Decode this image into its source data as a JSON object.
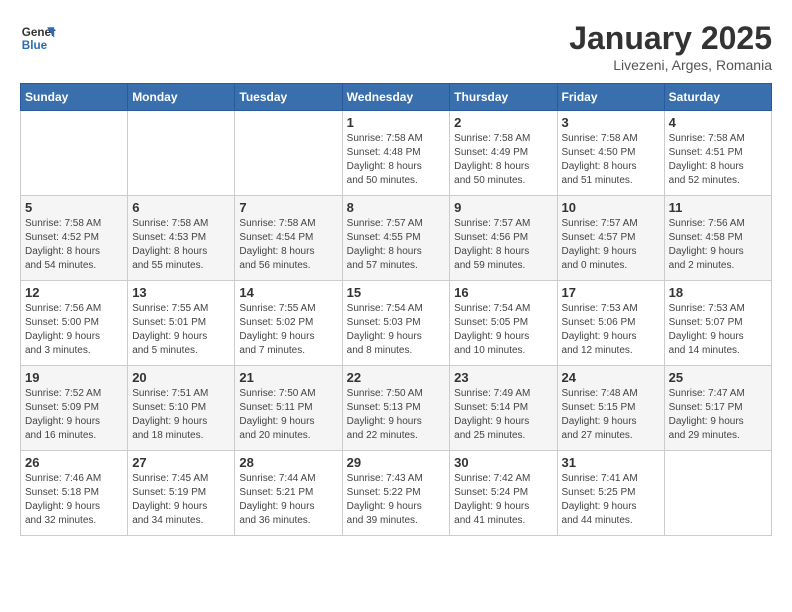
{
  "logo": {
    "general": "General",
    "blue": "Blue"
  },
  "title": "January 2025",
  "subtitle": "Livezeni, Arges, Romania",
  "days_header": [
    "Sunday",
    "Monday",
    "Tuesday",
    "Wednesday",
    "Thursday",
    "Friday",
    "Saturday"
  ],
  "weeks": [
    [
      {
        "day": "",
        "info": ""
      },
      {
        "day": "",
        "info": ""
      },
      {
        "day": "",
        "info": ""
      },
      {
        "day": "1",
        "info": "Sunrise: 7:58 AM\nSunset: 4:48 PM\nDaylight: 8 hours\nand 50 minutes."
      },
      {
        "day": "2",
        "info": "Sunrise: 7:58 AM\nSunset: 4:49 PM\nDaylight: 8 hours\nand 50 minutes."
      },
      {
        "day": "3",
        "info": "Sunrise: 7:58 AM\nSunset: 4:50 PM\nDaylight: 8 hours\nand 51 minutes."
      },
      {
        "day": "4",
        "info": "Sunrise: 7:58 AM\nSunset: 4:51 PM\nDaylight: 8 hours\nand 52 minutes."
      }
    ],
    [
      {
        "day": "5",
        "info": "Sunrise: 7:58 AM\nSunset: 4:52 PM\nDaylight: 8 hours\nand 54 minutes."
      },
      {
        "day": "6",
        "info": "Sunrise: 7:58 AM\nSunset: 4:53 PM\nDaylight: 8 hours\nand 55 minutes."
      },
      {
        "day": "7",
        "info": "Sunrise: 7:58 AM\nSunset: 4:54 PM\nDaylight: 8 hours\nand 56 minutes."
      },
      {
        "day": "8",
        "info": "Sunrise: 7:57 AM\nSunset: 4:55 PM\nDaylight: 8 hours\nand 57 minutes."
      },
      {
        "day": "9",
        "info": "Sunrise: 7:57 AM\nSunset: 4:56 PM\nDaylight: 8 hours\nand 59 minutes."
      },
      {
        "day": "10",
        "info": "Sunrise: 7:57 AM\nSunset: 4:57 PM\nDaylight: 9 hours\nand 0 minutes."
      },
      {
        "day": "11",
        "info": "Sunrise: 7:56 AM\nSunset: 4:58 PM\nDaylight: 9 hours\nand 2 minutes."
      }
    ],
    [
      {
        "day": "12",
        "info": "Sunrise: 7:56 AM\nSunset: 5:00 PM\nDaylight: 9 hours\nand 3 minutes."
      },
      {
        "day": "13",
        "info": "Sunrise: 7:55 AM\nSunset: 5:01 PM\nDaylight: 9 hours\nand 5 minutes."
      },
      {
        "day": "14",
        "info": "Sunrise: 7:55 AM\nSunset: 5:02 PM\nDaylight: 9 hours\nand 7 minutes."
      },
      {
        "day": "15",
        "info": "Sunrise: 7:54 AM\nSunset: 5:03 PM\nDaylight: 9 hours\nand 8 minutes."
      },
      {
        "day": "16",
        "info": "Sunrise: 7:54 AM\nSunset: 5:05 PM\nDaylight: 9 hours\nand 10 minutes."
      },
      {
        "day": "17",
        "info": "Sunrise: 7:53 AM\nSunset: 5:06 PM\nDaylight: 9 hours\nand 12 minutes."
      },
      {
        "day": "18",
        "info": "Sunrise: 7:53 AM\nSunset: 5:07 PM\nDaylight: 9 hours\nand 14 minutes."
      }
    ],
    [
      {
        "day": "19",
        "info": "Sunrise: 7:52 AM\nSunset: 5:09 PM\nDaylight: 9 hours\nand 16 minutes."
      },
      {
        "day": "20",
        "info": "Sunrise: 7:51 AM\nSunset: 5:10 PM\nDaylight: 9 hours\nand 18 minutes."
      },
      {
        "day": "21",
        "info": "Sunrise: 7:50 AM\nSunset: 5:11 PM\nDaylight: 9 hours\nand 20 minutes."
      },
      {
        "day": "22",
        "info": "Sunrise: 7:50 AM\nSunset: 5:13 PM\nDaylight: 9 hours\nand 22 minutes."
      },
      {
        "day": "23",
        "info": "Sunrise: 7:49 AM\nSunset: 5:14 PM\nDaylight: 9 hours\nand 25 minutes."
      },
      {
        "day": "24",
        "info": "Sunrise: 7:48 AM\nSunset: 5:15 PM\nDaylight: 9 hours\nand 27 minutes."
      },
      {
        "day": "25",
        "info": "Sunrise: 7:47 AM\nSunset: 5:17 PM\nDaylight: 9 hours\nand 29 minutes."
      }
    ],
    [
      {
        "day": "26",
        "info": "Sunrise: 7:46 AM\nSunset: 5:18 PM\nDaylight: 9 hours\nand 32 minutes."
      },
      {
        "day": "27",
        "info": "Sunrise: 7:45 AM\nSunset: 5:19 PM\nDaylight: 9 hours\nand 34 minutes."
      },
      {
        "day": "28",
        "info": "Sunrise: 7:44 AM\nSunset: 5:21 PM\nDaylight: 9 hours\nand 36 minutes."
      },
      {
        "day": "29",
        "info": "Sunrise: 7:43 AM\nSunset: 5:22 PM\nDaylight: 9 hours\nand 39 minutes."
      },
      {
        "day": "30",
        "info": "Sunrise: 7:42 AM\nSunset: 5:24 PM\nDaylight: 9 hours\nand 41 minutes."
      },
      {
        "day": "31",
        "info": "Sunrise: 7:41 AM\nSunset: 5:25 PM\nDaylight: 9 hours\nand 44 minutes."
      },
      {
        "day": "",
        "info": ""
      }
    ]
  ]
}
